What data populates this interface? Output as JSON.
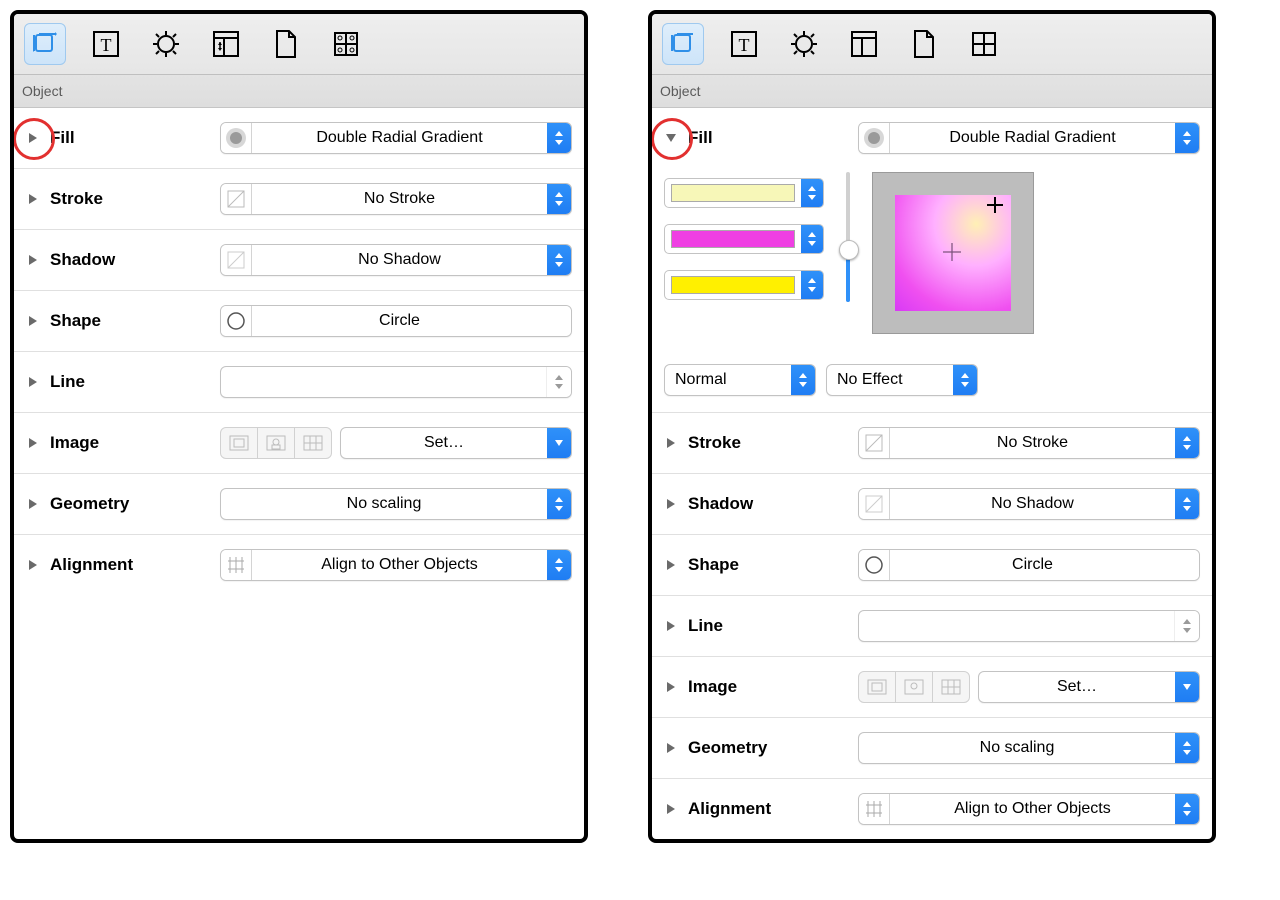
{
  "toolbar": {
    "tabs": [
      "object",
      "text",
      "properties",
      "canvas",
      "document",
      "grid"
    ]
  },
  "section_header": "Object",
  "rows": {
    "fill": {
      "label": "Fill",
      "value": "Double Radial Gradient"
    },
    "stroke": {
      "label": "Stroke",
      "value": "No Stroke"
    },
    "shadow": {
      "label": "Shadow",
      "value": "No Shadow"
    },
    "shape": {
      "label": "Shape",
      "value": "Circle"
    },
    "line": {
      "label": "Line",
      "value": ""
    },
    "image": {
      "label": "Image",
      "set_label": "Set…"
    },
    "geometry": {
      "label": "Geometry",
      "value": "No scaling"
    },
    "alignment": {
      "label": "Alignment",
      "value": "Align to Other Objects"
    }
  },
  "fill_expanded": {
    "stops": [
      {
        "color": "#f7f7b8"
      },
      {
        "color": "#ef3fe3"
      },
      {
        "color": "#fff000"
      }
    ],
    "blend_mode": "Normal",
    "effect": "No Effect"
  }
}
